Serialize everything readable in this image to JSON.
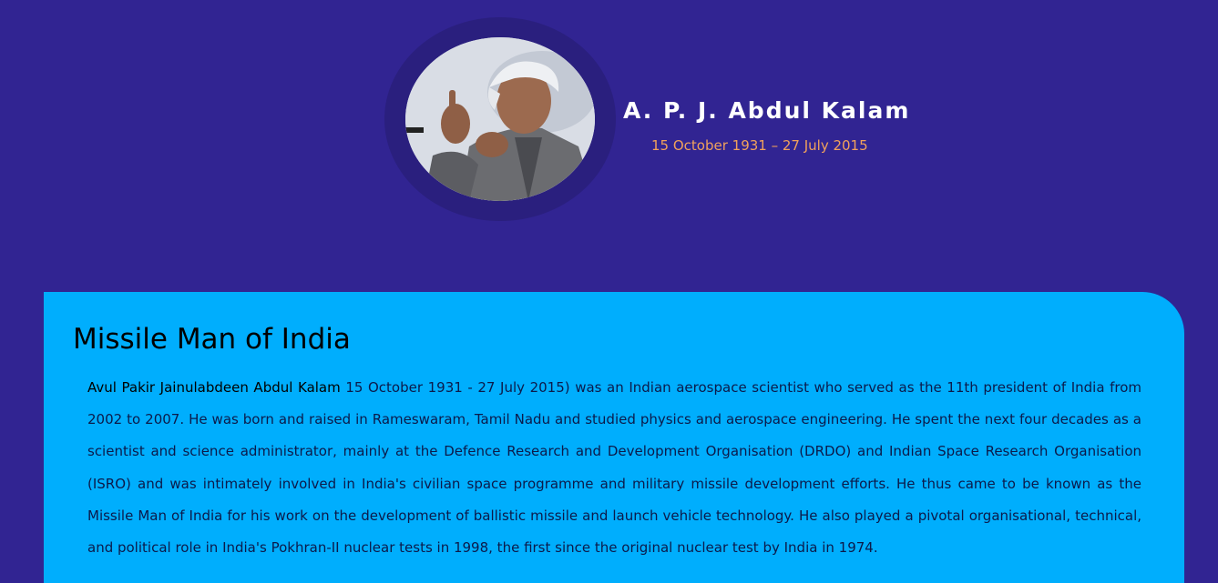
{
  "profile": {
    "name": "A. P. J. Abdul Kalam",
    "dates": "15 October 1931 – 27 July 2015",
    "photo_icon": "portrait-photo"
  },
  "section": {
    "title": "Missile Man of India",
    "bio_name": "Avul Pakir Jainulabdeen Abdul Kalam",
    "bio_text": " 15 October 1931 - 27 July 2015) was an Indian aerospace scientist who served as the 11th president of India from 2002 to 2007. He was born and raised in Rameswaram, Tamil Nadu and studied physics and aerospace engineering. He spent the next four decades as a scientist and science administrator, mainly at the Defence Research and Development Organisation (DRDO) and Indian Space Research Organisation (ISRO) and was intimately involved in India's civilian space programme and military missile development efforts. He thus came to be known as the Missile Man of India for his work on the development of ballistic missile and launch vehicle technology. He also played a pivotal organisational, technical, and political role in India's Pokhran-II nuclear tests in 1998, the first since the original nuclear test by India in 1974."
  },
  "colors": {
    "page_bg": "#312492",
    "ring": "#2a1f7e",
    "name": "#ffffff",
    "dates": "#f0a15c",
    "card_bg": "#00aefd"
  }
}
